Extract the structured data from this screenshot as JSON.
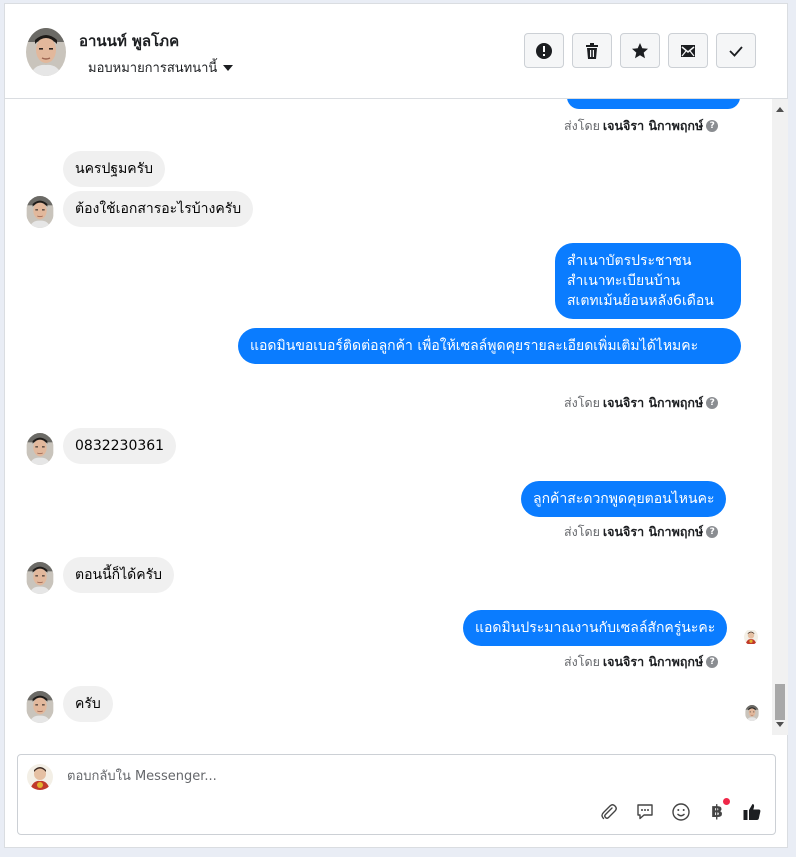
{
  "header": {
    "contact_name": "อานนท์ พูลโภค",
    "assign_label": "มอบหมายการสนทนานี้",
    "actions": [
      {
        "name": "mark-spam-button",
        "icon": "alert-circle-icon"
      },
      {
        "name": "delete-button",
        "icon": "trash-icon"
      },
      {
        "name": "star-button",
        "icon": "star-icon"
      },
      {
        "name": "mark-unread-button",
        "icon": "mail-icon"
      },
      {
        "name": "mark-done-button",
        "icon": "check-icon"
      }
    ]
  },
  "sent_by": {
    "prefix": "ส่งโดย",
    "agent_name": "เจนจิรา นิกาพฤกษ์",
    "help": "?"
  },
  "messages": [
    {
      "direction": "in",
      "text": "นครปฐมครับ"
    },
    {
      "direction": "in",
      "text": "ต้องใช้เอกสารอะไรบ้างครับ"
    },
    {
      "direction": "out",
      "text": "สำเนาบัตรประชาชน\nสำเนาทะเบียนบ้าน\nสเตทเม้นย้อนหลัง6เดือน"
    },
    {
      "direction": "out",
      "text": "แอดมินขอเบอร์ติดต่อลูกค้า เพื่อให้เซลล์พูดคุยรายละเอียดเพิ่มเติมได้ไหมคะ"
    },
    {
      "direction": "in",
      "text": "0832230361"
    },
    {
      "direction": "out",
      "text": "ลูกค้าสะดวกพูดคุยตอนไหนคะ"
    },
    {
      "direction": "in",
      "text": "ตอนนี้ก็ได้ครับ"
    },
    {
      "direction": "out",
      "text": "แอดมินประมาณงานกับเซลล์สักครู่นะคะ"
    },
    {
      "direction": "in",
      "text": "ครับ"
    }
  ],
  "composer": {
    "placeholder": "ตอบกลับใน Messenger...",
    "value": "",
    "currency_symbol": "฿"
  },
  "colors": {
    "outgoing_bubble": "#0a7cff",
    "incoming_bubble": "#f0f0f0",
    "like_icon": "#1c1e21",
    "notification_dot": "#f02849"
  }
}
